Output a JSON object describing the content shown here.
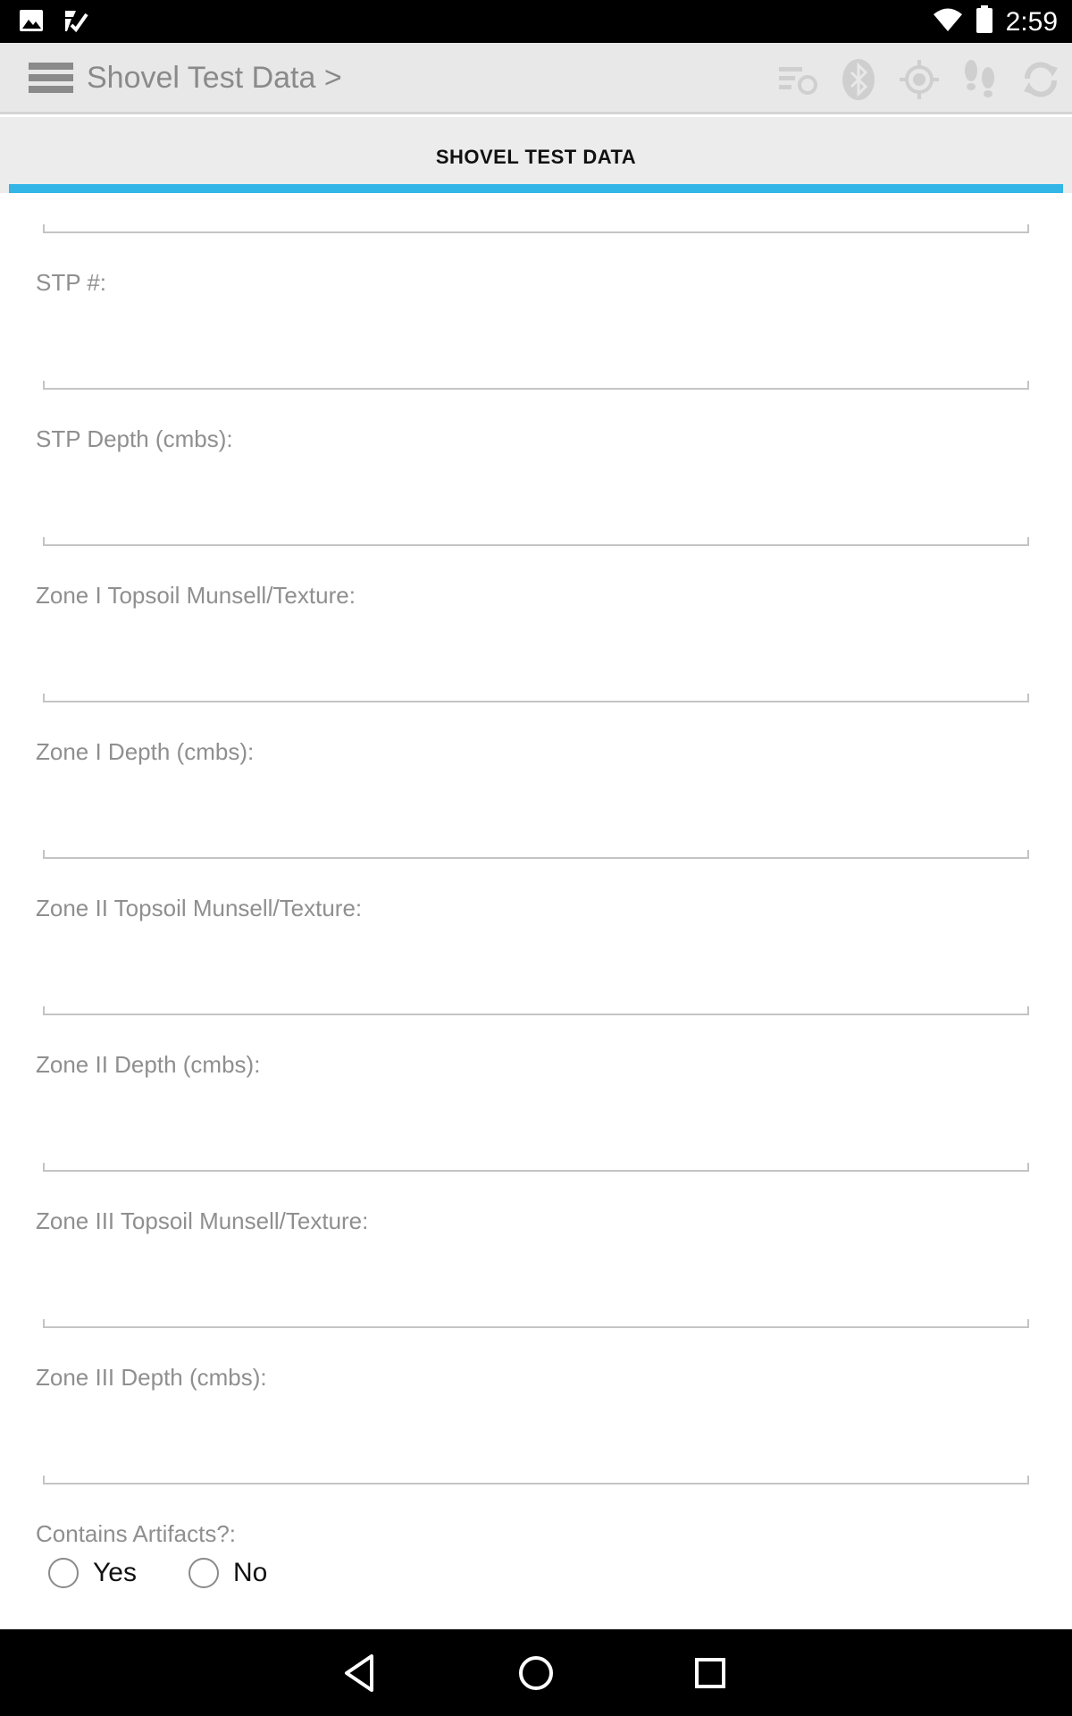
{
  "status_bar": {
    "time": "2:59",
    "icons": [
      "image-icon",
      "check-notification-icon",
      "wifi-icon",
      "battery-icon"
    ]
  },
  "action_bar": {
    "title": "Shovel Test Data >",
    "icons": [
      "list-sync-icon",
      "bluetooth-icon",
      "gps-target-icon",
      "footprints-icon",
      "refresh-icon"
    ]
  },
  "tab": {
    "label": "SHOVEL TEST DATA",
    "indicator_color": "#33b5e5"
  },
  "form": {
    "fields": [
      {
        "label": "STP #:",
        "value": ""
      },
      {
        "label": "STP Depth (cmbs):",
        "value": ""
      },
      {
        "label": "Zone I Topsoil Munsell/Texture:",
        "value": ""
      },
      {
        "label": "Zone I Depth (cmbs):",
        "value": ""
      },
      {
        "label": "Zone II Topsoil Munsell/Texture:",
        "value": ""
      },
      {
        "label": "Zone II Depth (cmbs):",
        "value": ""
      },
      {
        "label": "Zone III Topsoil Munsell/Texture:",
        "value": ""
      },
      {
        "label": "Zone III Depth (cmbs):",
        "value": ""
      }
    ],
    "artifacts": {
      "label": "Contains Artifacts?:",
      "options": [
        "Yes",
        "No"
      ],
      "selected": null
    }
  },
  "nav_bar": {
    "buttons": [
      "back-icon",
      "home-icon",
      "recents-icon"
    ]
  }
}
